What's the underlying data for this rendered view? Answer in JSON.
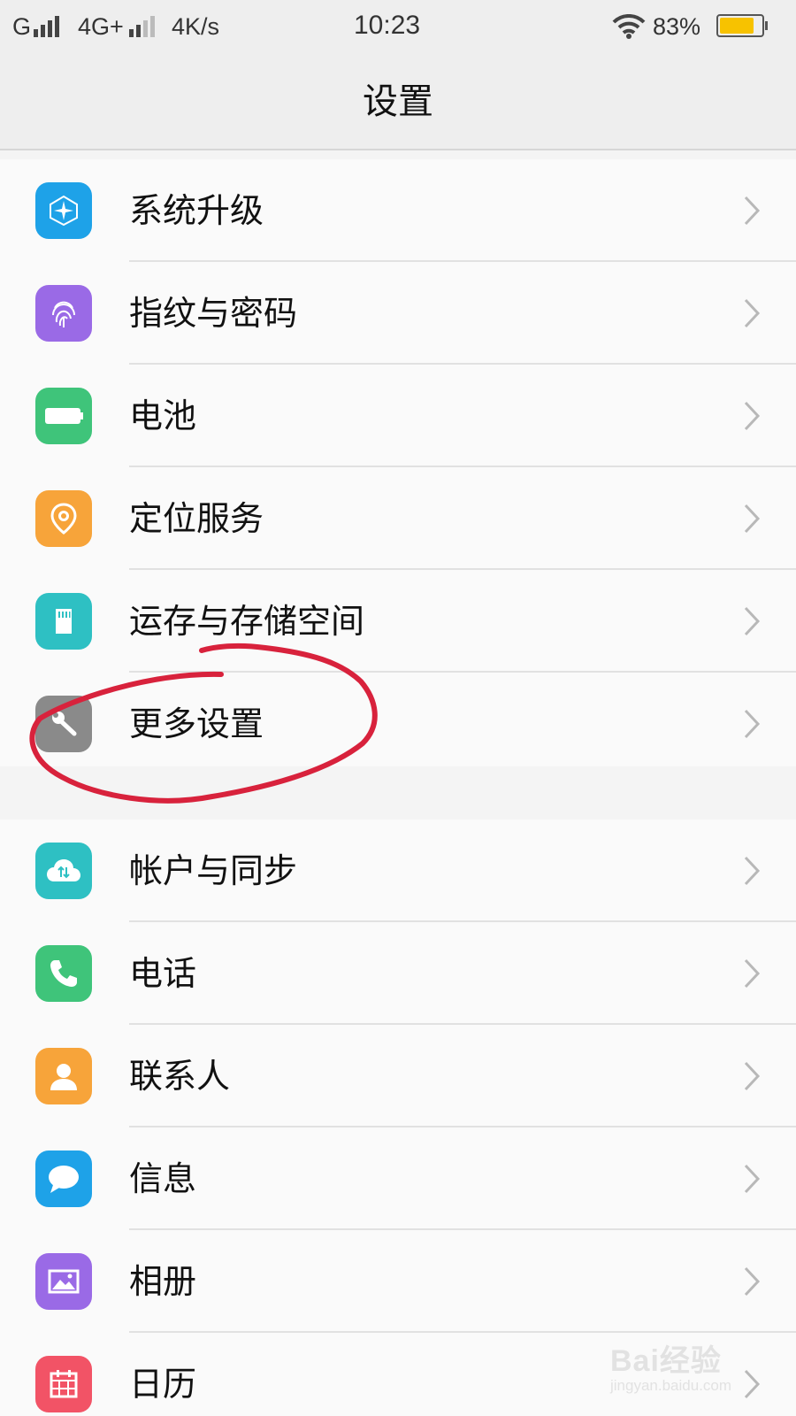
{
  "status_bar": {
    "carrier1": "G",
    "carrier2": "4G+",
    "speed": "4K/s",
    "time": "10:23",
    "battery_percent": "83%",
    "battery_level": 0.83,
    "battery_color": "#f7c200"
  },
  "header": {
    "title": "设置"
  },
  "sections": [
    {
      "items": [
        {
          "label": "系统升级",
          "icon": "system-update-icon",
          "color": "#1ea2e8"
        },
        {
          "label": "指纹与密码",
          "icon": "fingerprint-icon",
          "color": "#9a6ae6"
        },
        {
          "label": "电池",
          "icon": "battery-icon",
          "color": "#3fc47a"
        },
        {
          "label": "定位服务",
          "icon": "location-pin-icon",
          "color": "#f7a43a"
        },
        {
          "label": "运存与存储空间",
          "icon": "sd-card-icon",
          "color": "#2ec0c3"
        },
        {
          "label": "更多设置",
          "icon": "wrench-icon",
          "color": "#8a8a8a"
        }
      ]
    },
    {
      "items": [
        {
          "label": "帐户与同步",
          "icon": "cloud-sync-icon",
          "color": "#2ec0c3"
        },
        {
          "label": "电话",
          "icon": "phone-icon",
          "color": "#3fc47a"
        },
        {
          "label": "联系人",
          "icon": "contact-person-icon",
          "color": "#f7a43a"
        },
        {
          "label": "信息",
          "icon": "message-bubble-icon",
          "color": "#1ea2e8"
        },
        {
          "label": "相册",
          "icon": "album-icon",
          "color": "#9a6ae6"
        },
        {
          "label": "日历",
          "icon": "calendar-icon",
          "color": "#f25366"
        }
      ]
    }
  ],
  "annotation": {
    "color": "#d8223c",
    "target": "更多设置"
  },
  "watermark": {
    "main": "Bai经验",
    "sub": "jingyan.baidu.com"
  }
}
